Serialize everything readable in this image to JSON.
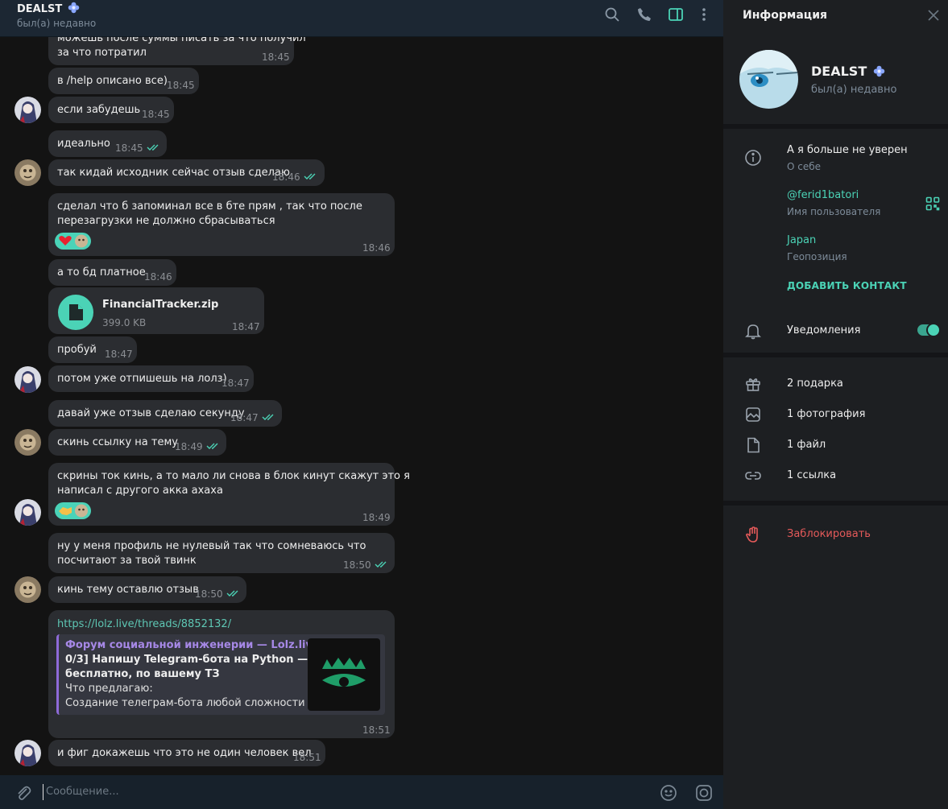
{
  "chat": {
    "title": "DEALST",
    "status": "был(а) недавно",
    "composer_placeholder": "Сообщение..."
  },
  "messages": [
    {
      "text": [
        "можешь после суммы писать за что получил",
        "за что потратил"
      ],
      "time": "18:45",
      "read": false
    },
    {
      "text": [
        "в /help описано все)"
      ],
      "time": "18:45",
      "read": false
    },
    {
      "text": [
        "если забудешь"
      ],
      "time": "18:45",
      "read": false
    },
    {
      "text": [
        "идеально"
      ],
      "time": "18:45",
      "read": true
    },
    {
      "text": [
        "так кидай исходник сейчас отзыв сделаю"
      ],
      "time": "18:46",
      "read": true
    },
    {
      "text": [
        "сделал что б запоминал все в бте прям , так что после",
        "перезагрузки не должно сбрасываться"
      ],
      "time": "18:46",
      "read": false,
      "reaction": "heart"
    },
    {
      "text": [
        "а то бд платное"
      ],
      "time": "18:46",
      "read": false
    },
    {
      "file": {
        "name": "FinancialTracker.zip",
        "size": "399.0 KB"
      },
      "time": "18:47",
      "read": false
    },
    {
      "text": [
        "пробуй"
      ],
      "time": "18:47",
      "read": false
    },
    {
      "text": [
        "потом уже отпишешь на лолз)"
      ],
      "time": "18:47",
      "read": false
    },
    {
      "text": [
        "давай уже отзыв сделаю секунду"
      ],
      "time": "18:47",
      "read": true
    },
    {
      "text": [
        "скинь ссылку на тему"
      ],
      "time": "18:49",
      "read": true
    },
    {
      "text": [
        "скрины ток кинь, а то мало ли снова в блок кинут скажут это я",
        "написал с другого акка ахаха"
      ],
      "time": "18:49",
      "read": false,
      "reaction": "handshake"
    },
    {
      "text": [
        "ну у меня профиль не нулевый так что сомневаюсь что",
        "посчитают за твой твинк"
      ],
      "time": "18:50",
      "read": true
    },
    {
      "text": [
        "кинь тему оставлю отзыв"
      ],
      "time": "18:50",
      "read": true
    },
    {
      "link": "https://lolz.live/threads/8852132/",
      "preview": {
        "site": "Форум социальной инженерии —  Lolz.live...",
        "title": [
          "0/3] Напишу Telegram-бота на Python —",
          "бесплатно, по вашему ТЗ"
        ],
        "desc": [
          "Что предлагаю:",
          "Создание телеграм-бота любой сложности н..."
        ]
      },
      "time": "18:51",
      "read": false
    },
    {
      "text": [
        "и фиг докажешь что это не один человек вел"
      ],
      "time": "18:51",
      "read": false
    }
  ],
  "info": {
    "title": "Информация",
    "name": "DEALST",
    "status": "был(а) недавно",
    "bio": "А я больше не уверен",
    "bio_label": "О себе",
    "username": "@ferid1batori",
    "username_label": "Имя пользователя",
    "location": "Japan",
    "location_label": "Геопозиция",
    "add_contact": "ДОБАВИТЬ КОНТАКТ",
    "notifications": "Уведомления",
    "notifications_on": true,
    "gifts": "2 подарка",
    "photos": "1 фотография",
    "files": "1 файл",
    "links": "1 ссылка",
    "block": "Заблокировать"
  },
  "colors": {
    "accent": "#4bd3b6",
    "danger": "#e55a5a",
    "bubble": "#2b2d31",
    "link_preview_site": "#a688e6"
  }
}
